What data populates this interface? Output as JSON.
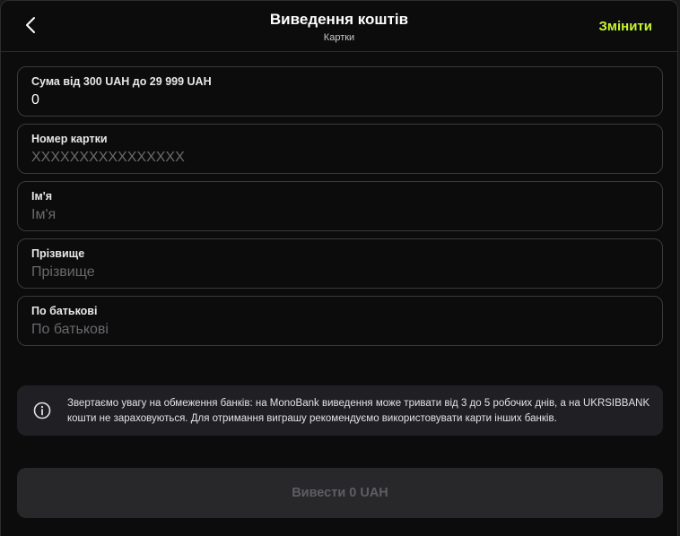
{
  "header": {
    "title": "Виведення коштів",
    "subtitle": "Картки",
    "change_label": "Змінити",
    "back_icon": "chevron-left-icon"
  },
  "fields": [
    {
      "label": "Сума від 300 UAH до 29 999 UAH",
      "value": "0",
      "placeholder": ""
    },
    {
      "label": "Номер картки",
      "value": "",
      "placeholder": "XXXXXXXXXXXXXXXX"
    },
    {
      "label": "Ім'я",
      "value": "",
      "placeholder": "Ім'я"
    },
    {
      "label": "Прізвище",
      "value": "",
      "placeholder": "Прізвище"
    },
    {
      "label": "По батькові",
      "value": "",
      "placeholder": "По батькові"
    }
  ],
  "notice": {
    "icon": "info-icon",
    "text": "Звертаємо увагу на обмеження банків: на MonoBank виведення може тривати від 3 до 5 робочих днів, а на UKRSIBBANK кошти не зараховуються. Для отримання виграшу рекомендуємо використовувати карти інших банків."
  },
  "submit": {
    "label": "Вивести 0 UAH",
    "disabled": true
  },
  "colors": {
    "accent": "#c6f432",
    "background": "#0c0c0d",
    "field_border": "#3a3a3d",
    "notice_bg": "#202024",
    "button_bg": "#28282b"
  }
}
